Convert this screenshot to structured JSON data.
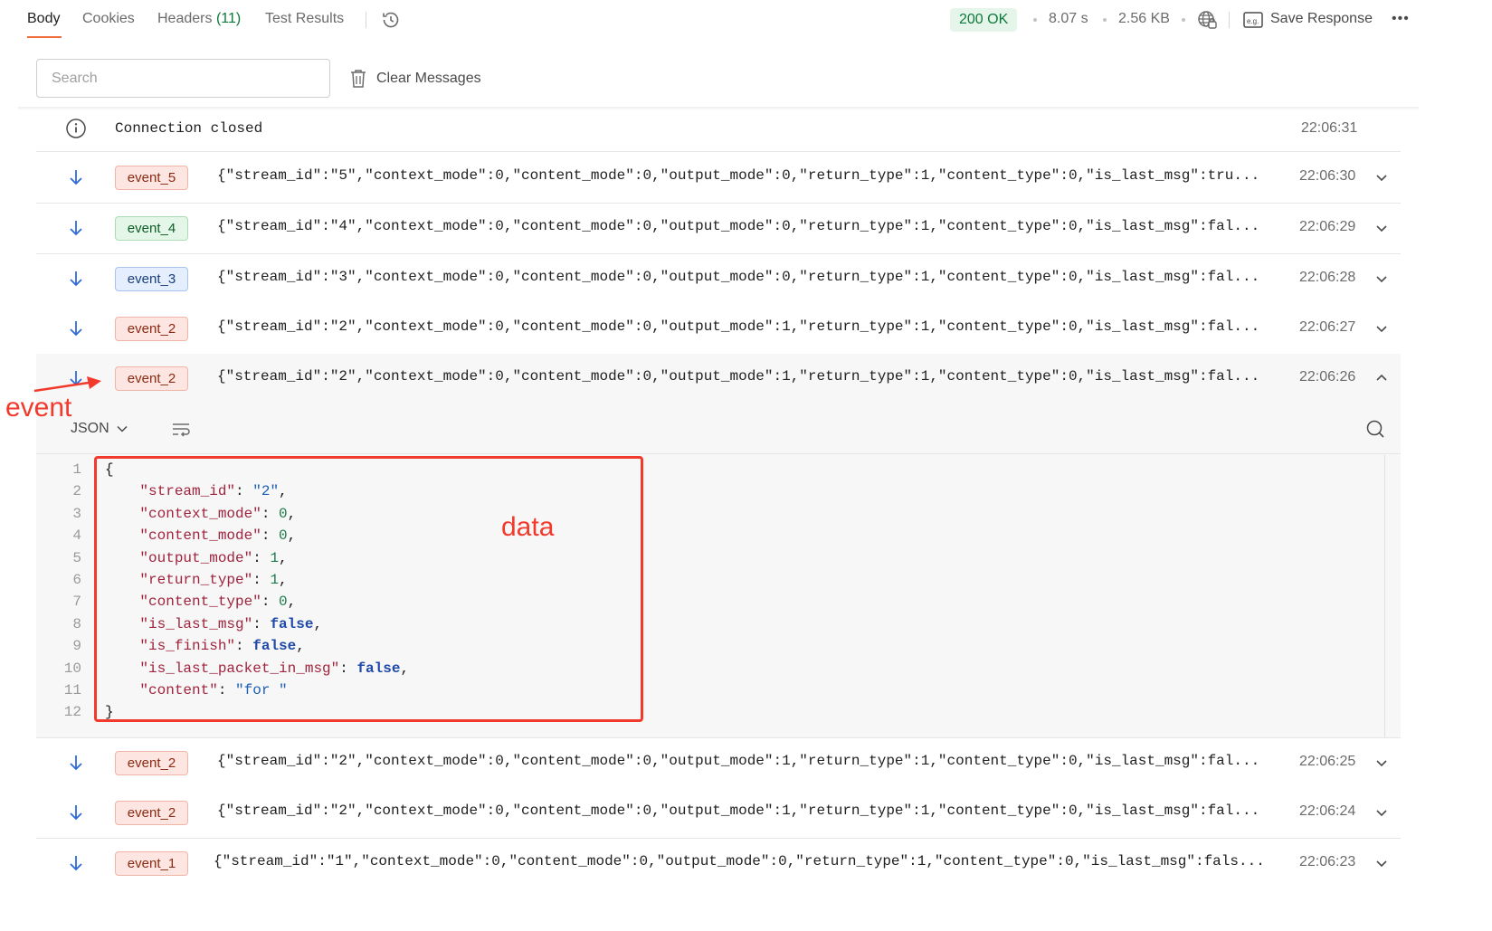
{
  "tabs": [
    {
      "label": "Body"
    },
    {
      "label": "Cookies"
    },
    {
      "label": "Headers",
      "count": "(11)"
    },
    {
      "label": "Test Results"
    }
  ],
  "response": {
    "status": "200 OK",
    "time": "8.07 s",
    "size": "2.56 KB",
    "save_label": "Save Response",
    "more": "•••"
  },
  "toolbar": {
    "search_placeholder": "Search",
    "clear_label": "Clear Messages"
  },
  "connection": {
    "text": "Connection closed",
    "time": "22:06:31"
  },
  "colors": {
    "accent": "#f26b3a",
    "status_ok": "#0c7a3a",
    "annotation": "#f23a2c"
  },
  "messages": [
    {
      "event": "event_5",
      "badge": "red",
      "text": "{\"stream_id\":\"5\",\"context_mode\":0,\"content_mode\":0,\"output_mode\":0,\"return_type\":1,\"content_type\":0,\"is_last_msg\":tru...",
      "time": "22:06:30",
      "chevron": "chevron-down-icon"
    },
    {
      "event": "event_4",
      "badge": "green",
      "text": "{\"stream_id\":\"4\",\"context_mode\":0,\"content_mode\":0,\"output_mode\":0,\"return_type\":1,\"content_type\":0,\"is_last_msg\":fal...",
      "time": "22:06:29",
      "chevron": "chevron-down-icon"
    },
    {
      "event": "event_3",
      "badge": "blue",
      "text": "{\"stream_id\":\"3\",\"context_mode\":0,\"content_mode\":0,\"output_mode\":0,\"return_type\":1,\"content_type\":0,\"is_last_msg\":fal...",
      "time": "22:06:28",
      "chevron": "chevron-down-icon"
    },
    {
      "event": "event_2",
      "badge": "red",
      "text": "{\"stream_id\":\"2\",\"context_mode\":0,\"content_mode\":0,\"output_mode\":1,\"return_type\":1,\"content_type\":0,\"is_last_msg\":fal...",
      "time": "22:06:27",
      "chevron": "chevron-down-icon"
    },
    {
      "event": "event_2",
      "badge": "red",
      "text": "{\"stream_id\":\"2\",\"context_mode\":0,\"content_mode\":0,\"output_mode\":1,\"return_type\":1,\"content_type\":0,\"is_last_msg\":fal...",
      "time": "22:06:26",
      "chevron": "chevron-up-icon"
    },
    {
      "event": "event_2",
      "badge": "red",
      "text": "{\"stream_id\":\"2\",\"context_mode\":0,\"content_mode\":0,\"output_mode\":1,\"return_type\":1,\"content_type\":0,\"is_last_msg\":fal...",
      "time": "22:06:25",
      "chevron": "chevron-down-icon"
    },
    {
      "event": "event_2",
      "badge": "red",
      "text": "{\"stream_id\":\"2\",\"context_mode\":0,\"content_mode\":0,\"output_mode\":1,\"return_type\":1,\"content_type\":0,\"is_last_msg\":fal...",
      "time": "22:06:24",
      "chevron": "chevron-down-icon"
    },
    {
      "event": "event_1",
      "badge": "red",
      "text": "{\"stream_id\":\"1\",\"context_mode\":0,\"content_mode\":0,\"output_mode\":0,\"return_type\":1,\"content_type\":0,\"is_last_msg\":fals...",
      "time": "22:06:23",
      "chevron": "chevron-down-icon"
    }
  ],
  "expanded": {
    "format": "JSON",
    "lines": [
      {
        "n": "1",
        "tokens": [
          [
            "p",
            "{"
          ]
        ]
      },
      {
        "n": "2",
        "tokens": [
          [
            "p",
            "    "
          ],
          [
            "k",
            "\"stream_id\""
          ],
          [
            "p",
            ": "
          ],
          [
            "s",
            "\"2\""
          ],
          [
            "p",
            ","
          ]
        ]
      },
      {
        "n": "3",
        "tokens": [
          [
            "p",
            "    "
          ],
          [
            "k",
            "\"context_mode\""
          ],
          [
            "p",
            ": "
          ],
          [
            "n",
            "0"
          ],
          [
            "p",
            ","
          ]
        ]
      },
      {
        "n": "4",
        "tokens": [
          [
            "p",
            "    "
          ],
          [
            "k",
            "\"content_mode\""
          ],
          [
            "p",
            ": "
          ],
          [
            "n",
            "0"
          ],
          [
            "p",
            ","
          ]
        ]
      },
      {
        "n": "5",
        "tokens": [
          [
            "p",
            "    "
          ],
          [
            "k",
            "\"output_mode\""
          ],
          [
            "p",
            ": "
          ],
          [
            "n",
            "1"
          ],
          [
            "p",
            ","
          ]
        ]
      },
      {
        "n": "6",
        "tokens": [
          [
            "p",
            "    "
          ],
          [
            "k",
            "\"return_type\""
          ],
          [
            "p",
            ": "
          ],
          [
            "n",
            "1"
          ],
          [
            "p",
            ","
          ]
        ]
      },
      {
        "n": "7",
        "tokens": [
          [
            "p",
            "    "
          ],
          [
            "k",
            "\"content_type\""
          ],
          [
            "p",
            ": "
          ],
          [
            "n",
            "0"
          ],
          [
            "p",
            ","
          ]
        ]
      },
      {
        "n": "8",
        "tokens": [
          [
            "p",
            "    "
          ],
          [
            "k",
            "\"is_last_msg\""
          ],
          [
            "p",
            ": "
          ],
          [
            "b",
            "false"
          ],
          [
            "p",
            ","
          ]
        ]
      },
      {
        "n": "9",
        "tokens": [
          [
            "p",
            "    "
          ],
          [
            "k",
            "\"is_finish\""
          ],
          [
            "p",
            ": "
          ],
          [
            "b",
            "false"
          ],
          [
            "p",
            ","
          ]
        ]
      },
      {
        "n": "10",
        "tokens": [
          [
            "p",
            "    "
          ],
          [
            "k",
            "\"is_last_packet_in_msg\""
          ],
          [
            "p",
            ": "
          ],
          [
            "b",
            "false"
          ],
          [
            "p",
            ","
          ]
        ]
      },
      {
        "n": "11",
        "tokens": [
          [
            "p",
            "    "
          ],
          [
            "k",
            "\"content\""
          ],
          [
            "p",
            ": "
          ],
          [
            "s",
            "\"for \""
          ]
        ]
      },
      {
        "n": "12",
        "tokens": [
          [
            "p",
            "}"
          ]
        ]
      }
    ]
  },
  "annotations": {
    "event_label": "event",
    "data_label": "data"
  }
}
